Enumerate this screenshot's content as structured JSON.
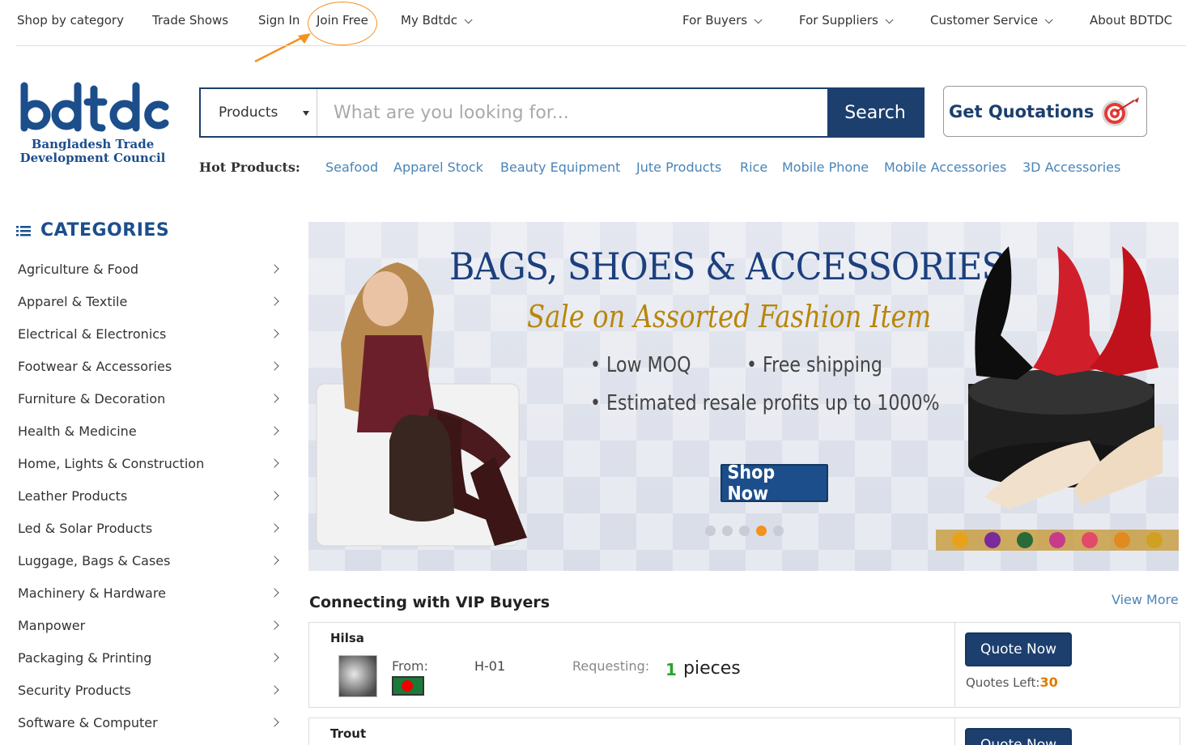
{
  "topnav": {
    "shop_by_category": "Shop by category",
    "trade_shows": "Trade Shows",
    "sign_in": "Sign In",
    "join_free": "Join Free",
    "my_bdtdc": "My Bdtdc",
    "for_buyers": "For Buyers",
    "for_suppliers": "For Suppliers",
    "customer_service": "Customer Service",
    "about": "About BDTDC",
    "annotation_color": "#f39220"
  },
  "logo": {
    "wordmark": "bdtdc",
    "subtitle_line1": "Bangladesh Trade",
    "subtitle_line2": "Development Council"
  },
  "search": {
    "category": "Products",
    "placeholder": "What are you looking for...",
    "button": "Search"
  },
  "quotations_button": "Get Quotations",
  "hot_products": {
    "label": "Hot Products:",
    "items": [
      "Seafood",
      "Apparel Stock",
      "Beauty Equipment",
      "Jute Products",
      "Rice",
      "Mobile Phone",
      "Mobile Accessories",
      "3D Accessories"
    ]
  },
  "categories": {
    "title": "CATEGORIES",
    "items": [
      "Agriculture & Food",
      "Apparel & Textile",
      "Electrical & Electronics",
      "Footwear & Accessories",
      "Furniture & Decoration",
      "Health & Medicine",
      "Home, Lights & Construction",
      "Leather Products",
      "Led & Solar Products",
      "Luggage, Bags & Cases",
      "Machinery & Hardware",
      "Manpower",
      "Packaging & Printing",
      "Security Products",
      "Software & Computer"
    ]
  },
  "banner": {
    "headline": "BAGS, SHOES & ACCESSORIES",
    "subheadline": "Sale on Assorted Fashion Item",
    "bullet1": "• Low MOQ",
    "bullet2": "• Free shipping",
    "bullet3": "• Estimated resale profits up to 1000%",
    "cta": "Shop Now",
    "slides": 5,
    "active_slide": 4
  },
  "vip": {
    "title": "Connecting with VIP Buyers",
    "view_more": "View More",
    "rows": [
      {
        "name": "Hilsa",
        "from_label": "From:",
        "code": "H-01",
        "requesting_label": "Requesting:",
        "quantity": "1",
        "unit": "pieces",
        "button": "Quote Now",
        "quotes_left_label": "Quotes Left:",
        "quotes_left": "30"
      },
      {
        "name": "Trout",
        "button": "Quote Now"
      }
    ]
  }
}
